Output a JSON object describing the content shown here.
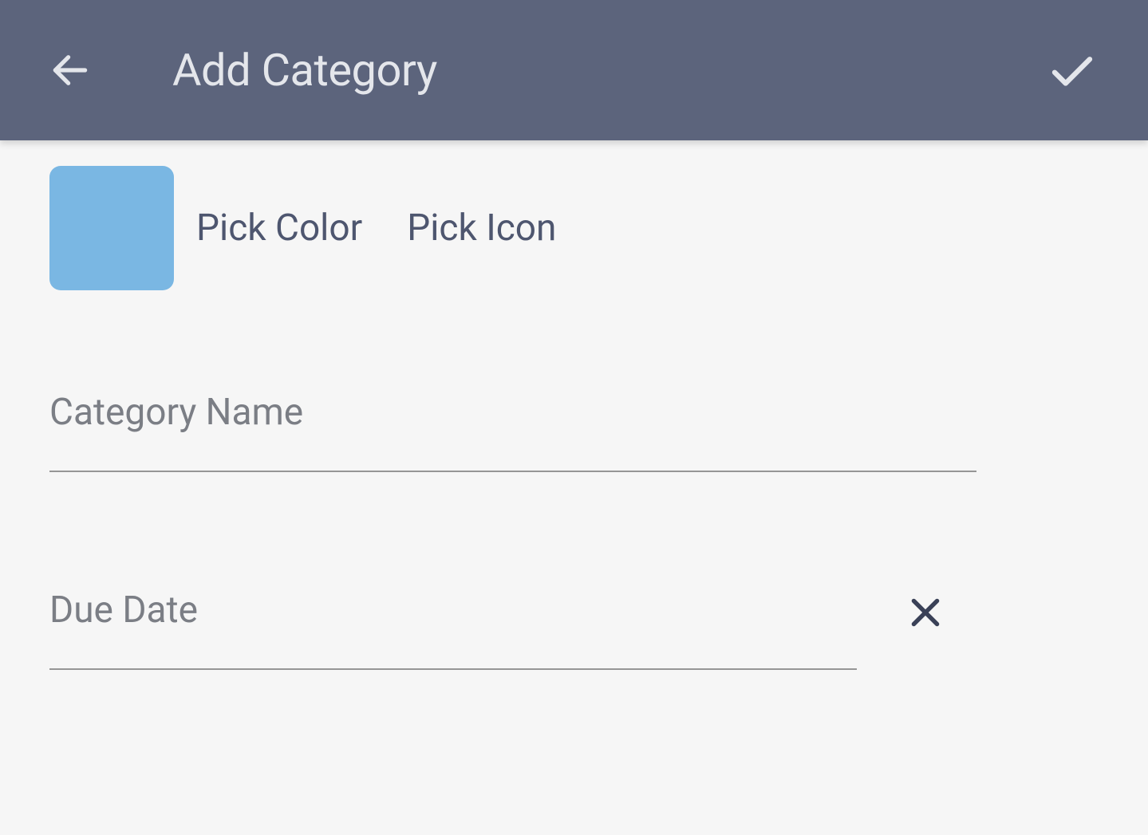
{
  "header": {
    "title": "Add Category"
  },
  "colorPicker": {
    "selected_color": "#7ab7e3",
    "pick_color_label": "Pick Color",
    "pick_icon_label": "Pick Icon"
  },
  "fields": {
    "category_name": {
      "placeholder": "Category Name",
      "value": ""
    },
    "due_date": {
      "placeholder": "Due Date",
      "value": ""
    }
  }
}
